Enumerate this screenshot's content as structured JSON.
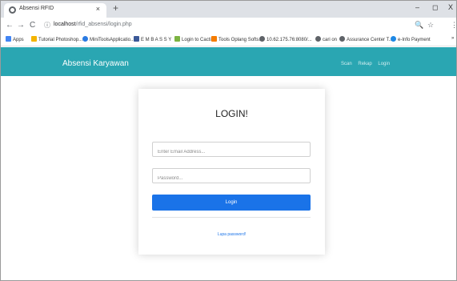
{
  "browser": {
    "tab": {
      "title": "Absensi RFID",
      "close": "×"
    },
    "new_tab": "+",
    "window_controls": {
      "minimize": "–",
      "maximize": "◻",
      "close": "X"
    },
    "nav": {
      "back": "←",
      "forward": "→",
      "reload": "C",
      "info": "ⓘ"
    },
    "url": {
      "host": "localhost",
      "path": "/rfid_absensi/login.php"
    },
    "toolbar_icons": {
      "zoom": "🔍",
      "star": "☆",
      "menu": "⋮"
    },
    "bookmarks": [
      {
        "label": "Apps",
        "color": "#4285f4"
      },
      {
        "label": "Tutorial Photoshop...",
        "color": "#f4b400"
      },
      {
        "label": "MiniToolsApplicatio...",
        "color": "#2a7ae2"
      },
      {
        "label": "E M B A S S Y",
        "color": "#3b5998"
      },
      {
        "label": "Login to Cacti",
        "color": "#7cb342"
      },
      {
        "label": "Tools Oplang Softs...",
        "color": "#f57c00"
      },
      {
        "label": "10.62.175.76:8080/...",
        "color": "#5f6368"
      },
      {
        "label": "cari on",
        "color": "#5f6368"
      },
      {
        "label": "Assurance Center T...",
        "color": "#5f6368"
      },
      {
        "label": "e-Info Payment",
        "color": "#1e88e5"
      }
    ],
    "bookmarks_more": "»"
  },
  "navbar": {
    "brand": "Absensi Karyawan",
    "links": [
      "Scan",
      "Rekap",
      "Login"
    ],
    "color": "#2aa6b2"
  },
  "login": {
    "heading": "LOGIN!",
    "email_placeholder": "Enter Email Address...",
    "password_placeholder": "Password...",
    "button": "Login",
    "forgot": "Lupa password!",
    "button_color": "#1a73e8"
  }
}
